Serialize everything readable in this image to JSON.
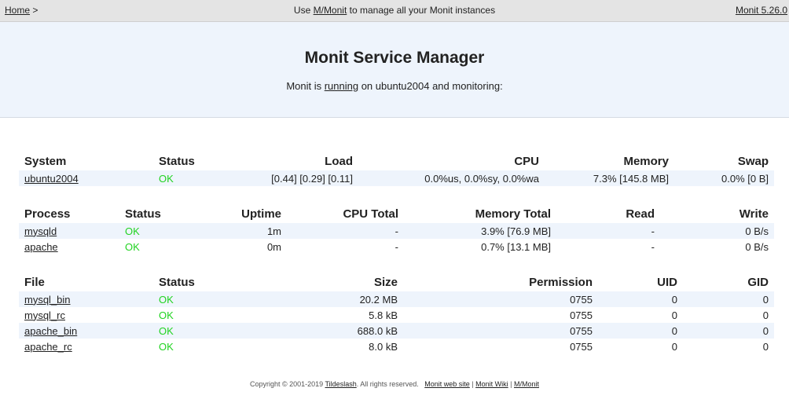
{
  "topbar": {
    "home": "Home",
    "sep": " >",
    "center_prefix": "Use ",
    "center_link": "M/Monit",
    "center_suffix": " to manage all your Monit instances",
    "version": "Monit 5.26.0"
  },
  "header": {
    "title": "Monit Service Manager",
    "sub_prefix": "Monit is ",
    "sub_link": "running",
    "sub_suffix": " on ubuntu2004 and monitoring:"
  },
  "system": {
    "headers": [
      "System",
      "Status",
      "Load",
      "CPU",
      "Memory",
      "Swap"
    ],
    "rows": [
      {
        "name": "ubuntu2004",
        "status": "OK",
        "load": "[0.44] [0.29] [0.11]",
        "cpu": "0.0%us, 0.0%sy, 0.0%wa",
        "memory": "7.3% [145.8 MB]",
        "swap": "0.0% [0 B]"
      }
    ]
  },
  "process": {
    "headers": [
      "Process",
      "Status",
      "Uptime",
      "CPU Total",
      "Memory Total",
      "Read",
      "Write"
    ],
    "rows": [
      {
        "name": "mysqld",
        "status": "OK",
        "uptime": "1m",
        "cpu": "-",
        "memory": "3.9% [76.9 MB]",
        "read": "-",
        "write": "0 B/s"
      },
      {
        "name": "apache",
        "status": "OK",
        "uptime": "0m",
        "cpu": "-",
        "memory": "0.7% [13.1 MB]",
        "read": "-",
        "write": "0 B/s"
      }
    ]
  },
  "file": {
    "headers": [
      "File",
      "Status",
      "Size",
      "Permission",
      "UID",
      "GID"
    ],
    "rows": [
      {
        "name": "mysql_bin",
        "status": "OK",
        "size": "20.2 MB",
        "perm": "0755",
        "uid": "0",
        "gid": "0"
      },
      {
        "name": "mysql_rc",
        "status": "OK",
        "size": "5.8 kB",
        "perm": "0755",
        "uid": "0",
        "gid": "0"
      },
      {
        "name": "apache_bin",
        "status": "OK",
        "size": "688.0 kB",
        "perm": "0755",
        "uid": "0",
        "gid": "0"
      },
      {
        "name": "apache_rc",
        "status": "OK",
        "size": "8.0 kB",
        "perm": "0755",
        "uid": "0",
        "gid": "0"
      }
    ]
  },
  "footer": {
    "copyright": "Copyright © 2001-2019 ",
    "company": "Tildeslash",
    "rights": ". All rights reserved.",
    "web": "Monit web site",
    "wiki": "Monit Wiki",
    "mmonit": "M/Monit",
    "pipe": " | "
  },
  "colors": {
    "ok": "#21d321",
    "row_shade": "#eef4fc"
  }
}
